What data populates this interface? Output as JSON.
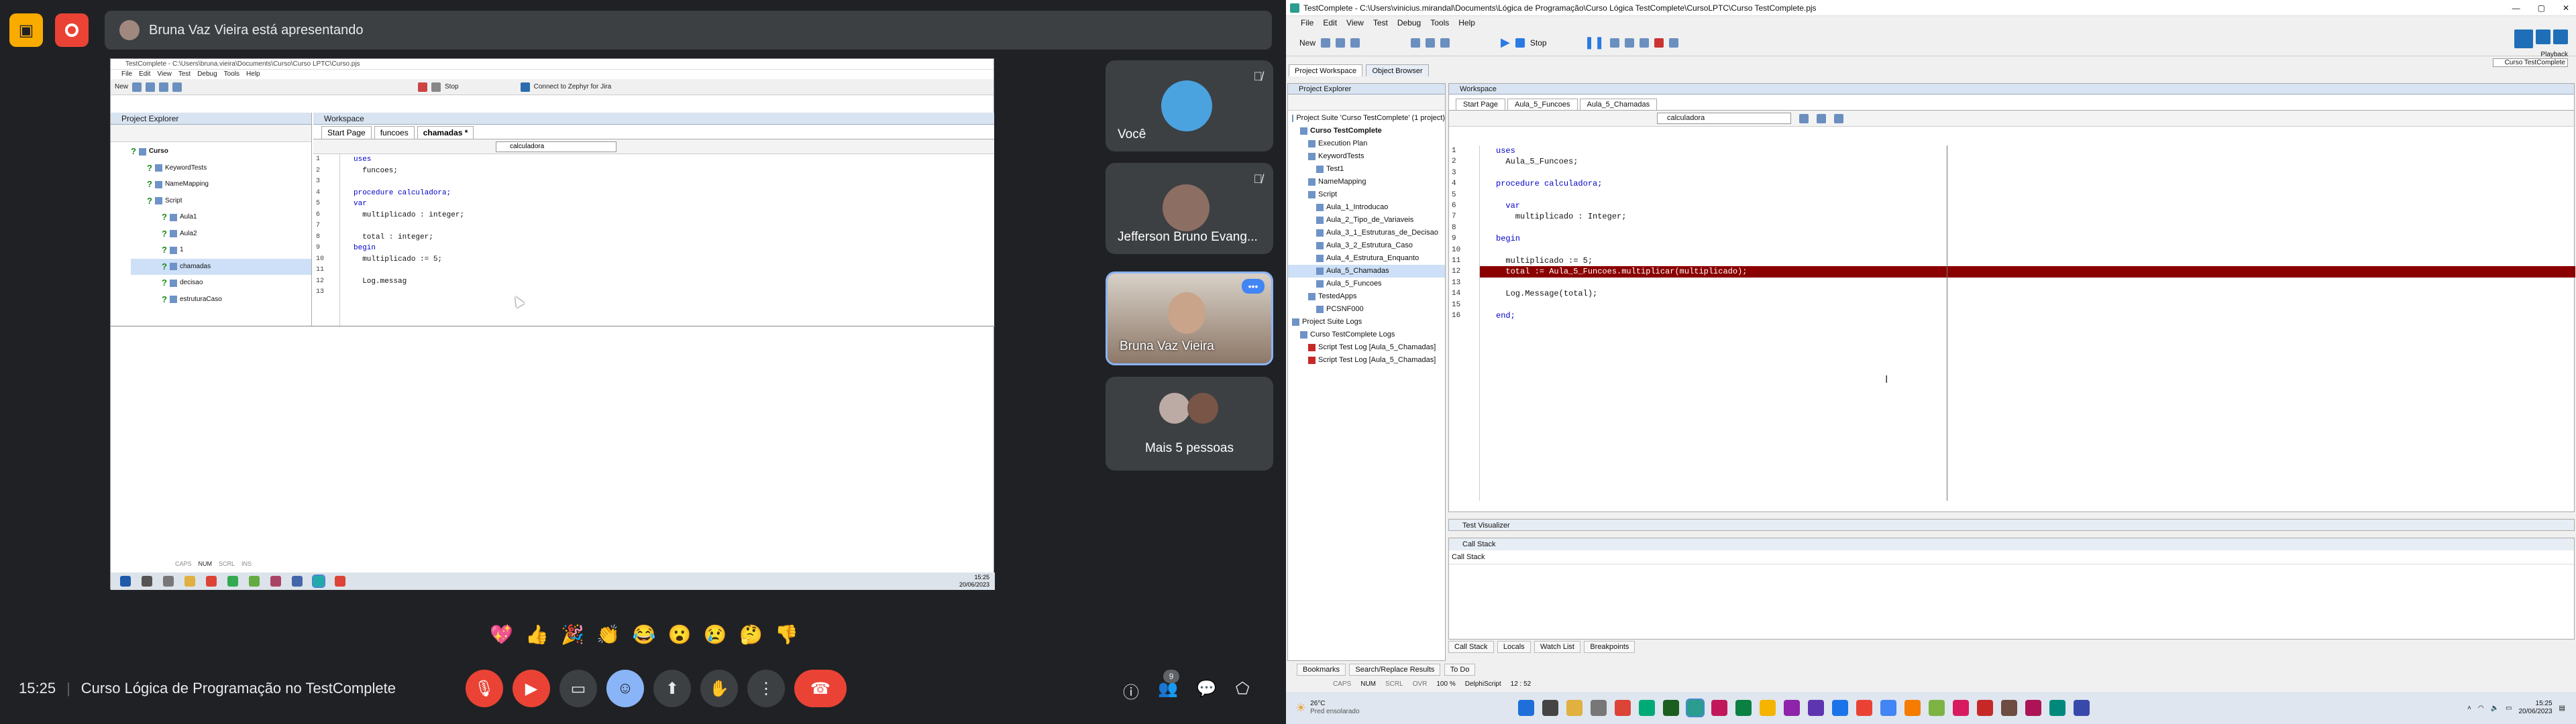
{
  "meet": {
    "presenting_text": "Bruna Vaz Vieira está apresentando",
    "participants": [
      {
        "name": "Você"
      },
      {
        "name": "Jefferson Bruno Evang..."
      },
      {
        "name": "Bruna Vaz Vieira"
      },
      {
        "name": "Mais 5 pessoas"
      }
    ],
    "time": "15:25",
    "meeting_title": "Curso Lógica de Programação no TestComplete",
    "participant_count": "9",
    "reactions": [
      "💖",
      "👍",
      "🎉",
      "👏",
      "😂",
      "😮",
      "😢",
      "🤔",
      "👎"
    ]
  },
  "shared": {
    "title": "TestComplete - C:\\Users\\bruna.vieira\\Documents\\Curso\\Curso LPTC\\Curso.pjs",
    "menu": [
      "File",
      "Edit",
      "View",
      "Test",
      "Debug",
      "Tools",
      "Help"
    ],
    "toolbar": {
      "new": "New",
      "stop": "Stop",
      "zephyr": "Connect to Zephyr for Jira"
    },
    "project_explorer": "Project Explorer",
    "workspace": "Workspace",
    "tabs": [
      "Start Page",
      "funcoes",
      "chamadas *"
    ],
    "routine_select": "calculadora",
    "tree": [
      "Curso",
      "KeywordTests",
      "NameMapping",
      "Script",
      "Aula1",
      "Aula2",
      "1",
      "chamadas",
      "decisao",
      "estruturaCaso"
    ],
    "code": [
      "uses",
      "  funcoes;",
      "",
      "procedure calculadora;",
      "var",
      "  multiplicado : integer;",
      "",
      "  total : integer;",
      "begin",
      "  multiplicado := 5;",
      "",
      "  Log.messag"
    ],
    "status": [
      "CAPS",
      "NUM",
      "SCRL",
      "INS"
    ],
    "clock_time": "15:25",
    "clock_date": "20/06/2023"
  },
  "tc": {
    "title": "TestComplete - C:\\Users\\vinicius.mirandal\\Documents\\Lógica de Programação\\Curso Lógica TestComplete\\CursoLPTC\\Curso TestComplete.pjs",
    "menu": [
      "File",
      "Edit",
      "View",
      "Test",
      "Debug",
      "Tools",
      "Help"
    ],
    "toolbar": {
      "new": "New",
      "stop": "Stop"
    },
    "tooltip_playback": "Playback",
    "tooltip_suite": "Curso TestComplete",
    "left_tabs": [
      "Project Workspace",
      "Object Browser"
    ],
    "project_explorer": "Project Explorer",
    "workspace": "Workspace",
    "doc_tabs": [
      "Start Page",
      "Aula_5_Funcoes",
      "Aula_5_Chamadas"
    ],
    "routine_select": "calculadora",
    "tree": [
      {
        "label": "Project Suite 'Curso TestComplete' (1 project)",
        "indent": 0
      },
      {
        "label": "Curso TestComplete",
        "indent": 1,
        "bold": true
      },
      {
        "label": "Execution Plan",
        "indent": 2
      },
      {
        "label": "KeywordTests",
        "indent": 2
      },
      {
        "label": "Test1",
        "indent": 3
      },
      {
        "label": "NameMapping",
        "indent": 2
      },
      {
        "label": "Script",
        "indent": 2
      },
      {
        "label": "Aula_1_Introducao",
        "indent": 3
      },
      {
        "label": "Aula_2_Tipo_de_Variaveis",
        "indent": 3
      },
      {
        "label": "Aula_3_1_Estruturas_de_Decisao",
        "indent": 3
      },
      {
        "label": "Aula_3_2_Estrutura_Caso",
        "indent": 3
      },
      {
        "label": "Aula_4_Estrutura_Enquanto",
        "indent": 3
      },
      {
        "label": "Aula_5_Chamadas",
        "indent": 3,
        "selected": true
      },
      {
        "label": "Aula_5_Funcoes",
        "indent": 3
      },
      {
        "label": "TestedApps",
        "indent": 2
      },
      {
        "label": "PCSNF000",
        "indent": 3
      },
      {
        "label": "Project Suite Logs",
        "indent": 0
      },
      {
        "label": "Curso TestComplete Logs",
        "indent": 1
      },
      {
        "label": "Script Test Log [Aula_5_Chamadas]",
        "indent": 2
      },
      {
        "label": "Script Test Log [Aula_5_Chamadas]",
        "indent": 2
      }
    ],
    "code": [
      "uses",
      "  Aula_5_Funcoes;",
      "",
      "procedure calculadora;",
      "",
      "  var",
      "    multiplicado : Integer;",
      "",
      "begin",
      "",
      "  multiplicado := 5;",
      "  total := Aula_5_Funcoes.multiplicar(multiplicado);",
      "",
      "  Log.Message(total);",
      "",
      "end;"
    ],
    "error_line_index": 11,
    "test_visualizer": "Test Visualizer",
    "call_stack": "Call Stack",
    "call_stack_header": "Call Stack",
    "bottom_tabs": [
      "Call Stack",
      "Locals",
      "Watch List",
      "Breakpoints"
    ],
    "very_bottom_tabs": [
      "Bookmarks",
      "Search/Replace Results",
      "To Do"
    ],
    "status": [
      "CAPS",
      "NUM",
      "SCRL",
      "OVR",
      "100 %",
      "DelphiScript",
      "12 : 52"
    ],
    "weather_temp": "26°C",
    "weather_desc": "Pred ensolarado",
    "clock_time": "15:25",
    "clock_date": "20/06/2023"
  },
  "colors": {
    "error_line": "#8b0000",
    "meet_bg": "#202124",
    "end_call": "#ea4335"
  }
}
